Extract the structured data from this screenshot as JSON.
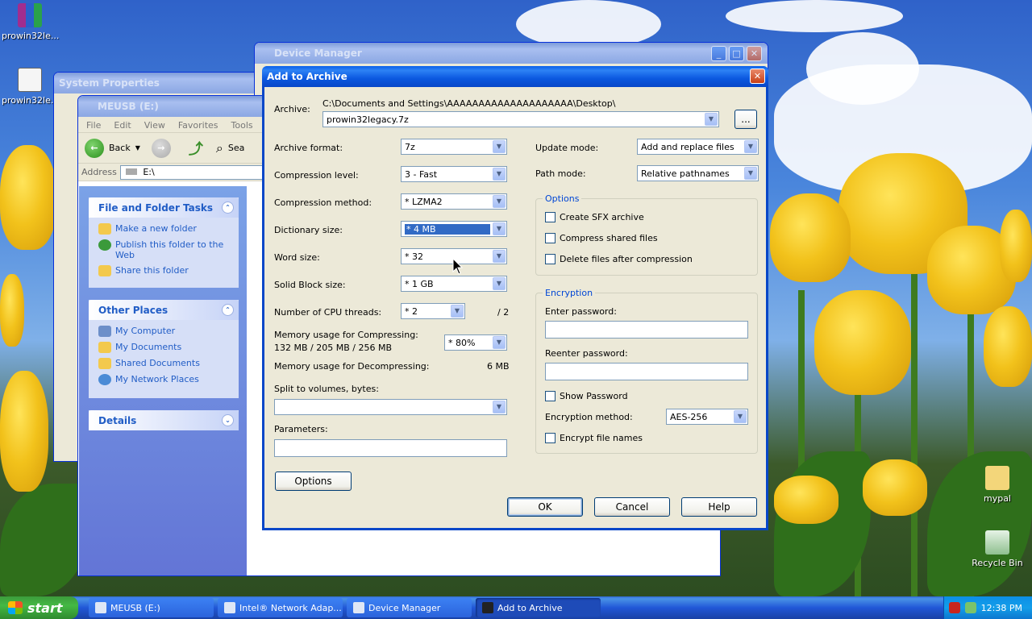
{
  "desktop": {
    "icons": [
      {
        "label": "prowin32le..."
      },
      {
        "label": "prowin32le..."
      },
      {
        "label": "mypal"
      },
      {
        "label": "Recycle Bin"
      }
    ]
  },
  "system_properties": {
    "title": "System Properties"
  },
  "device_manager": {
    "title": "Device Manager"
  },
  "explorer": {
    "title": "MEUSB (E:)",
    "menu": [
      "File",
      "Edit",
      "View",
      "Favorites",
      "Tools"
    ],
    "toolbar": {
      "back": "Back",
      "search": "Sea"
    },
    "address_label": "Address",
    "address_value": "E:\\",
    "file_tasks": {
      "title": "File and Folder Tasks",
      "items": [
        "Make a new folder",
        "Publish this folder to the Web",
        "Share this folder"
      ]
    },
    "other_places": {
      "title": "Other Places",
      "items": [
        "My Computer",
        "My Documents",
        "Shared Documents",
        "My Network Places"
      ]
    },
    "details": {
      "title": "Details"
    }
  },
  "dialog": {
    "title": "Add to Archive",
    "archive_label": "Archive:",
    "archive_path": "C:\\Documents and Settings\\AAAAAAAAAAAAAAAAAAAA\\Desktop\\",
    "archive_name": "prowin32legacy.7z",
    "browse_label": "...",
    "archive_format_label": "Archive format:",
    "archive_format": "7z",
    "compression_level_label": "Compression level:",
    "compression_level": "3 - Fast",
    "compression_method_label": "Compression method:",
    "compression_method": "* LZMA2",
    "dictionary_size_label": "Dictionary size:",
    "dictionary_size": "* 4 MB",
    "word_size_label": "Word size:",
    "word_size": "* 32",
    "solid_block_label": "Solid Block size:",
    "solid_block": "* 1 GB",
    "cpu_threads_label": "Number of CPU threads:",
    "cpu_threads": "* 2",
    "cpu_threads_max": "/ 2",
    "mem_compress_label": "Memory usage for Compressing:",
    "mem_compress_values": "132 MB / 205 MB / 256 MB",
    "mem_compress_pct": "* 80%",
    "mem_decompress_label": "Memory usage for Decompressing:",
    "mem_decompress_value": "6 MB",
    "split_label": "Split to volumes, bytes:",
    "split_value": "",
    "parameters_label": "Parameters:",
    "parameters_value": "",
    "options_button": "Options",
    "update_mode_label": "Update mode:",
    "update_mode": "Add and replace files",
    "path_mode_label": "Path mode:",
    "path_mode": "Relative pathnames",
    "options_group": {
      "title": "Options",
      "sfx": "Create SFX archive",
      "shared": "Compress shared files",
      "delete": "Delete files after compression"
    },
    "encryption": {
      "title": "Encryption",
      "enter_label": "Enter password:",
      "reenter_label": "Reenter password:",
      "show_password": "Show Password",
      "method_label": "Encryption method:",
      "method": "AES-256",
      "encrypt_names": "Encrypt file names"
    },
    "ok": "OK",
    "cancel": "Cancel",
    "help": "Help"
  },
  "taskbar": {
    "start": "start",
    "tasks": [
      "MEUSB (E:)",
      "Intel® Network Adap...",
      "Device Manager",
      "Add to Archive"
    ],
    "clock": "12:38 PM"
  }
}
